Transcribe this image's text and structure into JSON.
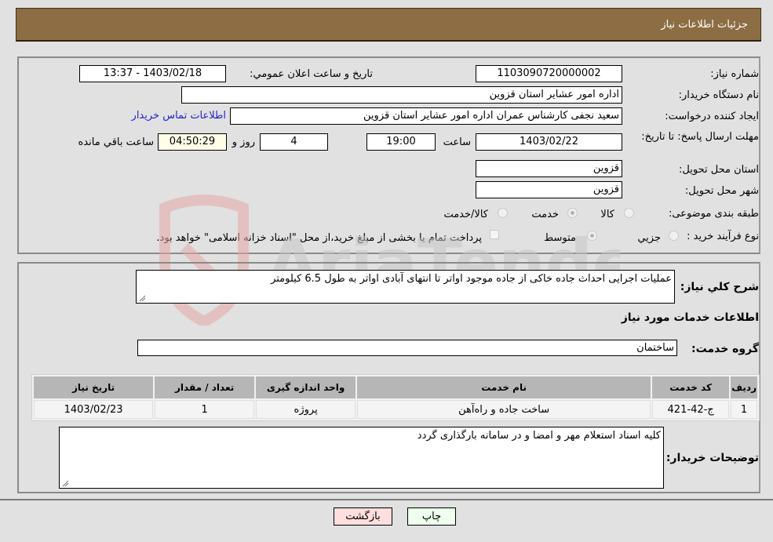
{
  "header": {
    "title": "جزئیات اطلاعات نیاز"
  },
  "form": {
    "need_number": {
      "label": "شماره نیاز:",
      "value": "1103090720000002"
    },
    "announce_datetime": {
      "label": "تاریخ و ساعت اعلان عمومي:",
      "value": "1403/02/18 - 13:37"
    },
    "buyer_org": {
      "label": "نام دستگاه خريدار:",
      "value": "اداره امور عشایر استان قزوین"
    },
    "creator": {
      "label": "ايجاد کننده درخواست:",
      "value": "سعید نجفی کارشناس عمران اداره امور عشایر استان قزوین"
    },
    "buyer_contact_link": "اطلاعات تماس خريدار",
    "deadline": {
      "label": "مهلت ارسال پاسخ: تا تاريخ:",
      "date": "1403/02/22",
      "time_label": "ساعت",
      "time": "19:00",
      "days": "4",
      "days_label": "روز و",
      "remaining": "04:50:29",
      "remaining_label": "ساعت باقي مانده"
    },
    "province": {
      "label": "استان محل تحويل:",
      "value": "قزوین"
    },
    "city": {
      "label": "شهر محل تحويل:",
      "value": "قزوین"
    },
    "category": {
      "label": "طبقه بندی موضوعی:",
      "options": [
        {
          "label": "کالا",
          "checked": false
        },
        {
          "label": "خدمت",
          "checked": true
        },
        {
          "label": "کالا/خدمت",
          "checked": false
        }
      ]
    },
    "purchase_type": {
      "label": "نوع فرآيند خريد :",
      "options": [
        {
          "label": "جزيي",
          "checked": false
        },
        {
          "label": "متوسط",
          "checked": true
        }
      ],
      "treasury_checkbox_label": "پرداخت تمام يا بخشی از مبلغ خريد،از محل \"اسناد خزانه اسلامی\" خواهد بود.",
      "treasury_checked": false
    }
  },
  "details": {
    "description_label": "شرح کلي نياز:",
    "description": "عملیات اجرایی احداث جاده خاکی از جاده موجود اواتر تا انتهای آبادی اواتر به طول 6.5 کیلومتر",
    "services_title": "اطلاعات خدمات مورد نياز",
    "service_group_label": "گروه خدمت:",
    "service_group": "ساختمان",
    "table": {
      "headers": [
        "رديف",
        "کد خدمت",
        "نام خدمت",
        "واحد اندازه گيری",
        "تعداد / مقدار",
        "تاريخ نياز"
      ],
      "rows": [
        [
          "1",
          "ج-42-421",
          "ساخت جاده و راه‌آهن",
          "پروژه",
          "1",
          "1403/02/23"
        ]
      ]
    },
    "buyer_notes_label": "توضيحات خريدار:",
    "buyer_notes": "کلیه اسناد استعلام مهر و امضا و در سامانه بارگذاری گردد"
  },
  "buttons": {
    "print": "چاپ",
    "back": "بازگشت"
  },
  "watermark": {
    "text": "AriaTender.neT"
  },
  "colors": {
    "header_bg": "#8d6d43",
    "page_bg": "#e1e1e1",
    "print_bg": "#efffed",
    "back_bg": "#ffdede",
    "link": "#2222cc"
  }
}
